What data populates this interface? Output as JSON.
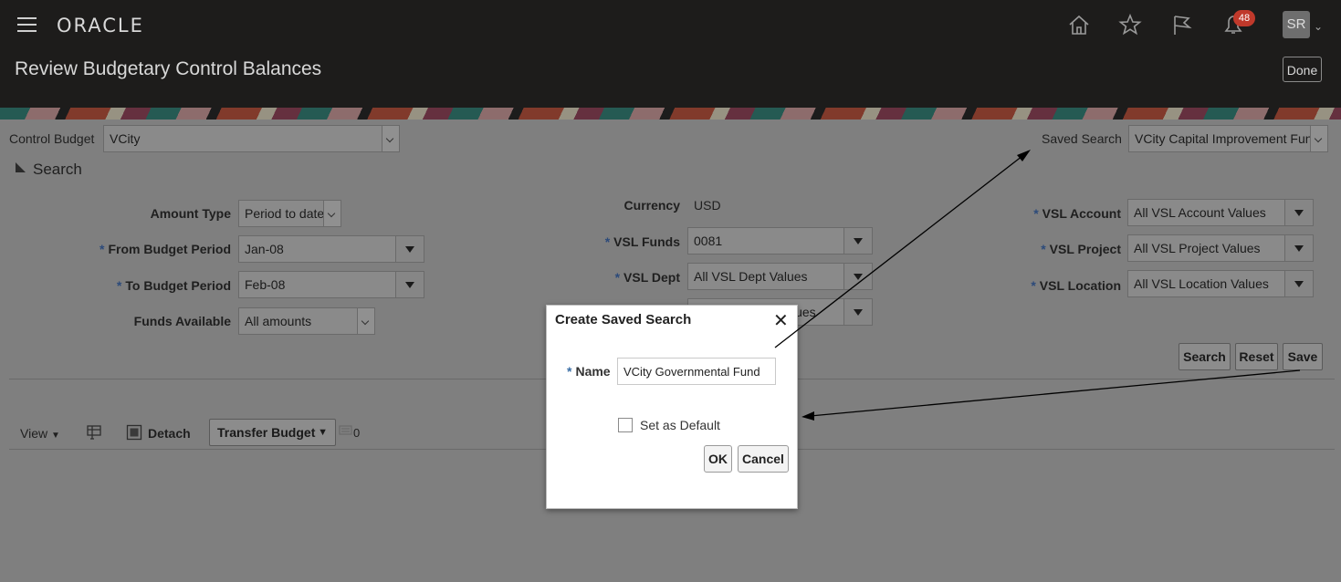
{
  "header": {
    "brand": "ORACLE",
    "page_title": "Review Budgetary Control Balances",
    "notification_count": "48",
    "user_initials": "SR",
    "done_label": "Done"
  },
  "control_budget": {
    "label": "Control Budget",
    "value": "VCity"
  },
  "saved_search": {
    "label": "Saved Search",
    "value": "VCity Capital Improvement Fund"
  },
  "search_section": {
    "title": "Search"
  },
  "fields": {
    "amount_type": {
      "label": "Amount Type",
      "value": "Period to date"
    },
    "from_budget_period": {
      "label": "From Budget Period",
      "value": "Jan-08"
    },
    "to_budget_period": {
      "label": "To Budget Period",
      "value": "Feb-08"
    },
    "funds_available": {
      "label": "Funds Available",
      "value": "All amounts"
    },
    "currency": {
      "label": "Currency",
      "value": "USD"
    },
    "vsl_funds": {
      "label": "VSL Funds",
      "value": "0081"
    },
    "vsl_dept": {
      "label": "VSL Dept",
      "value": "All VSL Dept Values"
    },
    "vsl_hidden_value": "lues",
    "vsl_account": {
      "label": "VSL Account",
      "value": "All VSL Account Values"
    },
    "vsl_project": {
      "label": "VSL Project",
      "value": "All VSL Project Values"
    },
    "vsl_location": {
      "label": "VSL Location",
      "value": "All VSL Location Values"
    }
  },
  "required_marker": "*",
  "search_buttons": {
    "search": "Search",
    "reset": "Reset",
    "save": "Save"
  },
  "toolbar": {
    "view": "View",
    "detach": "Detach",
    "transfer_budget": "Transfer Budget",
    "count": "0"
  },
  "dialog": {
    "title": "Create Saved Search",
    "name_label": "Name",
    "name_value": "VCity Governmental Fund",
    "set_default_label": "Set as Default",
    "ok_label": "OK",
    "cancel_label": "Cancel"
  }
}
